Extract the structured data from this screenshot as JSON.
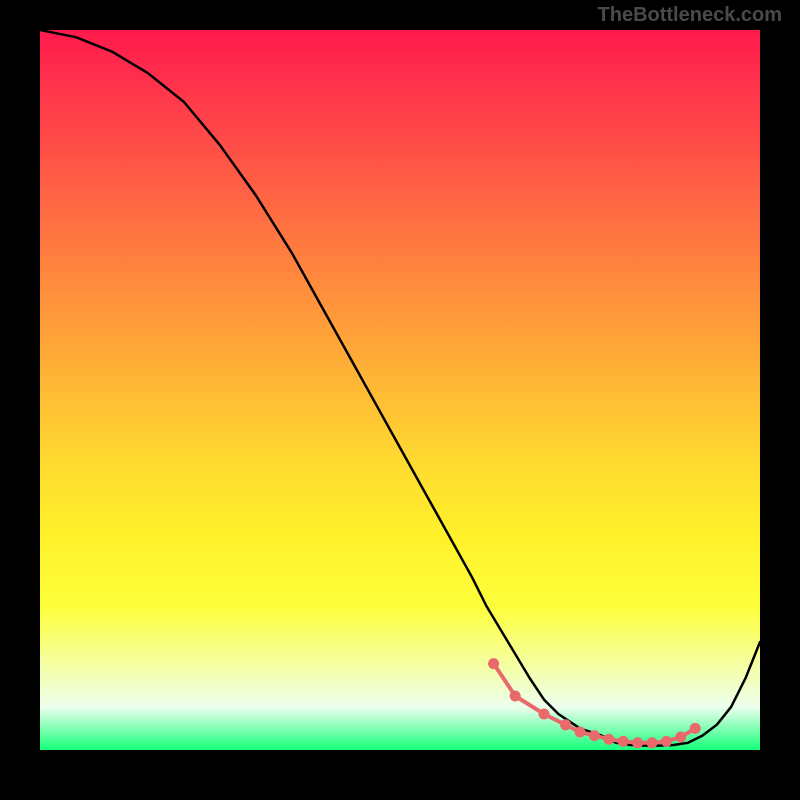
{
  "watermark": "TheBottleneck.com",
  "chart_data": {
    "type": "line",
    "title": "",
    "xlabel": "",
    "ylabel": "",
    "xlim": [
      0,
      100
    ],
    "ylim": [
      0,
      100
    ],
    "series": [
      {
        "name": "curve",
        "x": [
          0,
          5,
          10,
          15,
          20,
          25,
          30,
          35,
          40,
          45,
          50,
          55,
          60,
          62,
          65,
          68,
          70,
          72,
          75,
          78,
          80,
          82,
          84,
          86,
          88,
          90,
          92,
          94,
          96,
          98,
          100
        ],
        "values": [
          100,
          99,
          97,
          94,
          90,
          84,
          77,
          69,
          60,
          51,
          42,
          33,
          24,
          20,
          15,
          10,
          7,
          5,
          3,
          2,
          1,
          0.7,
          0.6,
          0.6,
          0.7,
          1,
          2,
          3.5,
          6,
          10,
          15
        ]
      }
    ],
    "markers": {
      "name": "highlight-points",
      "color": "#e86a6a",
      "x": [
        63,
        66,
        70,
        73,
        75,
        77,
        79,
        81,
        83,
        85,
        87,
        89,
        91
      ],
      "values": [
        12,
        7.5,
        5,
        3.5,
        2.5,
        2,
        1.5,
        1.2,
        1,
        1,
        1.2,
        1.8,
        3
      ]
    }
  }
}
